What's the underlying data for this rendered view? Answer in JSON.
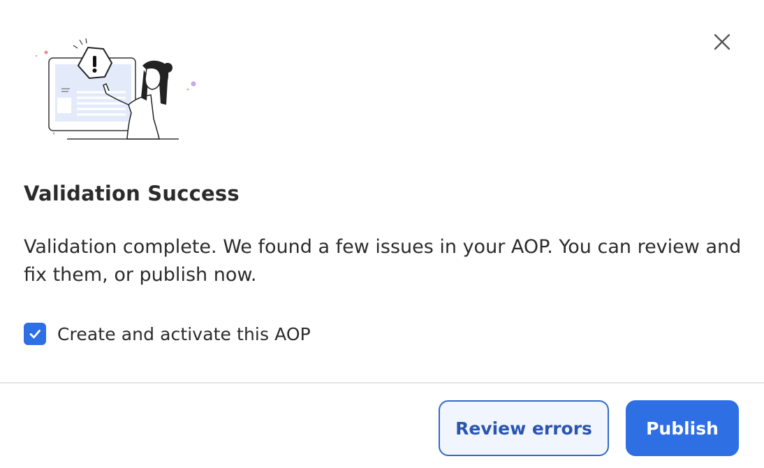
{
  "dialog": {
    "title": "Validation Success",
    "message": "Validation complete. We found a few issues in your AOP. You can review and fix them, or publish now.",
    "close_icon": "close-icon",
    "illustration": "person-pointing-at-warning-illustration"
  },
  "checkbox": {
    "label": "Create and activate this AOP",
    "checked": true
  },
  "footer": {
    "review_label": "Review errors",
    "publish_label": "Publish"
  },
  "colors": {
    "primary": "#2f6fe4",
    "secondary_border": "#3368c9",
    "secondary_text": "#2a56b0",
    "secondary_bg": "#f1f5fd",
    "text": "#2b2b2b"
  }
}
